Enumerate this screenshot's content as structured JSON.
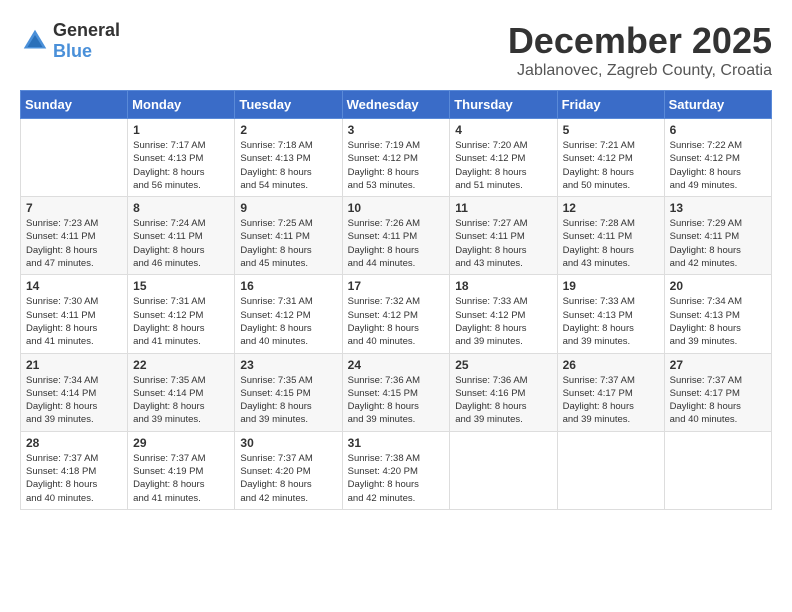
{
  "header": {
    "logo": {
      "general": "General",
      "blue": "Blue"
    },
    "title": "December 2025",
    "location": "Jablanovec, Zagreb County, Croatia"
  },
  "calendar": {
    "headers": [
      "Sunday",
      "Monday",
      "Tuesday",
      "Wednesday",
      "Thursday",
      "Friday",
      "Saturday"
    ],
    "weeks": [
      [
        {
          "day": "",
          "info": ""
        },
        {
          "day": "1",
          "info": "Sunrise: 7:17 AM\nSunset: 4:13 PM\nDaylight: 8 hours\nand 56 minutes."
        },
        {
          "day": "2",
          "info": "Sunrise: 7:18 AM\nSunset: 4:13 PM\nDaylight: 8 hours\nand 54 minutes."
        },
        {
          "day": "3",
          "info": "Sunrise: 7:19 AM\nSunset: 4:12 PM\nDaylight: 8 hours\nand 53 minutes."
        },
        {
          "day": "4",
          "info": "Sunrise: 7:20 AM\nSunset: 4:12 PM\nDaylight: 8 hours\nand 51 minutes."
        },
        {
          "day": "5",
          "info": "Sunrise: 7:21 AM\nSunset: 4:12 PM\nDaylight: 8 hours\nand 50 minutes."
        },
        {
          "day": "6",
          "info": "Sunrise: 7:22 AM\nSunset: 4:12 PM\nDaylight: 8 hours\nand 49 minutes."
        }
      ],
      [
        {
          "day": "7",
          "info": "Sunrise: 7:23 AM\nSunset: 4:11 PM\nDaylight: 8 hours\nand 47 minutes."
        },
        {
          "day": "8",
          "info": "Sunrise: 7:24 AM\nSunset: 4:11 PM\nDaylight: 8 hours\nand 46 minutes."
        },
        {
          "day": "9",
          "info": "Sunrise: 7:25 AM\nSunset: 4:11 PM\nDaylight: 8 hours\nand 45 minutes."
        },
        {
          "day": "10",
          "info": "Sunrise: 7:26 AM\nSunset: 4:11 PM\nDaylight: 8 hours\nand 44 minutes."
        },
        {
          "day": "11",
          "info": "Sunrise: 7:27 AM\nSunset: 4:11 PM\nDaylight: 8 hours\nand 43 minutes."
        },
        {
          "day": "12",
          "info": "Sunrise: 7:28 AM\nSunset: 4:11 PM\nDaylight: 8 hours\nand 43 minutes."
        },
        {
          "day": "13",
          "info": "Sunrise: 7:29 AM\nSunset: 4:11 PM\nDaylight: 8 hours\nand 42 minutes."
        }
      ],
      [
        {
          "day": "14",
          "info": "Sunrise: 7:30 AM\nSunset: 4:11 PM\nDaylight: 8 hours\nand 41 minutes."
        },
        {
          "day": "15",
          "info": "Sunrise: 7:31 AM\nSunset: 4:12 PM\nDaylight: 8 hours\nand 41 minutes."
        },
        {
          "day": "16",
          "info": "Sunrise: 7:31 AM\nSunset: 4:12 PM\nDaylight: 8 hours\nand 40 minutes."
        },
        {
          "day": "17",
          "info": "Sunrise: 7:32 AM\nSunset: 4:12 PM\nDaylight: 8 hours\nand 40 minutes."
        },
        {
          "day": "18",
          "info": "Sunrise: 7:33 AM\nSunset: 4:12 PM\nDaylight: 8 hours\nand 39 minutes."
        },
        {
          "day": "19",
          "info": "Sunrise: 7:33 AM\nSunset: 4:13 PM\nDaylight: 8 hours\nand 39 minutes."
        },
        {
          "day": "20",
          "info": "Sunrise: 7:34 AM\nSunset: 4:13 PM\nDaylight: 8 hours\nand 39 minutes."
        }
      ],
      [
        {
          "day": "21",
          "info": "Sunrise: 7:34 AM\nSunset: 4:14 PM\nDaylight: 8 hours\nand 39 minutes."
        },
        {
          "day": "22",
          "info": "Sunrise: 7:35 AM\nSunset: 4:14 PM\nDaylight: 8 hours\nand 39 minutes."
        },
        {
          "day": "23",
          "info": "Sunrise: 7:35 AM\nSunset: 4:15 PM\nDaylight: 8 hours\nand 39 minutes."
        },
        {
          "day": "24",
          "info": "Sunrise: 7:36 AM\nSunset: 4:15 PM\nDaylight: 8 hours\nand 39 minutes."
        },
        {
          "day": "25",
          "info": "Sunrise: 7:36 AM\nSunset: 4:16 PM\nDaylight: 8 hours\nand 39 minutes."
        },
        {
          "day": "26",
          "info": "Sunrise: 7:37 AM\nSunset: 4:17 PM\nDaylight: 8 hours\nand 39 minutes."
        },
        {
          "day": "27",
          "info": "Sunrise: 7:37 AM\nSunset: 4:17 PM\nDaylight: 8 hours\nand 40 minutes."
        }
      ],
      [
        {
          "day": "28",
          "info": "Sunrise: 7:37 AM\nSunset: 4:18 PM\nDaylight: 8 hours\nand 40 minutes."
        },
        {
          "day": "29",
          "info": "Sunrise: 7:37 AM\nSunset: 4:19 PM\nDaylight: 8 hours\nand 41 minutes."
        },
        {
          "day": "30",
          "info": "Sunrise: 7:37 AM\nSunset: 4:20 PM\nDaylight: 8 hours\nand 42 minutes."
        },
        {
          "day": "31",
          "info": "Sunrise: 7:38 AM\nSunset: 4:20 PM\nDaylight: 8 hours\nand 42 minutes."
        },
        {
          "day": "",
          "info": ""
        },
        {
          "day": "",
          "info": ""
        },
        {
          "day": "",
          "info": ""
        }
      ]
    ]
  }
}
